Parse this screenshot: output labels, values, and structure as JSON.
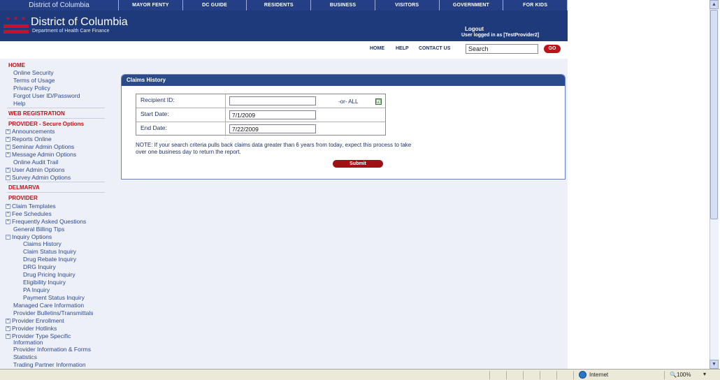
{
  "topnav": {
    "site_name": "District of Columbia",
    "items": [
      "MAYOR FENTY",
      "DC GUIDE",
      "RESIDENTS",
      "BUSINESS",
      "VISITORS",
      "GOVERNMENT",
      "FOR KIDS"
    ]
  },
  "banner": {
    "title": "District of Columbia",
    "subtitle": "Department of Health Care Finance",
    "logout": "Logout",
    "user_line": "User logged in as [TestProvider2]"
  },
  "utility": {
    "home": "HOME",
    "help": "HELP",
    "contact": "CONTACT US",
    "search_value": "Search",
    "go": "GO"
  },
  "sidebar": [
    {
      "label": "HOME",
      "kind": "header"
    },
    {
      "label": "Online Security",
      "kind": "link"
    },
    {
      "label": "Terms of Usage",
      "kind": "link"
    },
    {
      "label": "Privacy Policy",
      "kind": "link"
    },
    {
      "label": "Forgot User ID/Password",
      "kind": "link"
    },
    {
      "label": "Help",
      "kind": "link"
    },
    {
      "label": "WEB REGISTRATION",
      "kind": "header"
    },
    {
      "label": "PROVIDER - Secure Options",
      "kind": "header"
    },
    {
      "label": "Announcements",
      "kind": "expand"
    },
    {
      "label": "Reports Online",
      "kind": "expand"
    },
    {
      "label": "Seminar Admin Options",
      "kind": "expand"
    },
    {
      "label": "Message Admin Options",
      "kind": "expand"
    },
    {
      "label": "Online Audit Trail",
      "kind": "link"
    },
    {
      "label": "User Admin Options",
      "kind": "expand"
    },
    {
      "label": "Survey Admin Options",
      "kind": "expand"
    },
    {
      "label": "DELMARVA",
      "kind": "header"
    },
    {
      "label": "PROVIDER",
      "kind": "header"
    },
    {
      "label": "Claim Templates",
      "kind": "expand"
    },
    {
      "label": "Fee Schedules",
      "kind": "expand"
    },
    {
      "label": "Frequently Asked Questions",
      "kind": "expand"
    },
    {
      "label": "General Billing Tips",
      "kind": "link"
    },
    {
      "label": "Inquiry Options",
      "kind": "collapse"
    },
    {
      "label": "Claims History",
      "kind": "sub"
    },
    {
      "label": "Claim Status Inquiry",
      "kind": "sub"
    },
    {
      "label": "Drug Rebate Inquiry",
      "kind": "sub"
    },
    {
      "label": "DRG Inquiry",
      "kind": "sub"
    },
    {
      "label": "Drug Pricing Inquiry",
      "kind": "sub"
    },
    {
      "label": "Eligibility Inquiry",
      "kind": "sub"
    },
    {
      "label": "PA Inquiry",
      "kind": "sub"
    },
    {
      "label": "Payment Status Inquiry",
      "kind": "sub"
    },
    {
      "label": "Managed Care Information",
      "kind": "link"
    },
    {
      "label": "Provider Bulletins/Transmittals",
      "kind": "link"
    },
    {
      "label": "Provider Enrollment",
      "kind": "expand"
    },
    {
      "label": "Provider Hotlinks",
      "kind": "expand"
    },
    {
      "label": "Provider Type Specific",
      "kind": "expand"
    },
    {
      "label": "Information",
      "kind": "link"
    },
    {
      "label": "Provider Information & Forms",
      "kind": "link"
    },
    {
      "label": "Statistics",
      "kind": "link"
    },
    {
      "label": "Trading Partner Information",
      "kind": "link"
    }
  ],
  "panel": {
    "title": "Claims History",
    "recipient_label": "Recipient ID:",
    "recipient_value": "",
    "or_all": "-or-  ALL",
    "all_checked": "☑",
    "start_label": "Start Date:",
    "start_value": "7/1/2009",
    "end_label": "End Date:",
    "end_value": "7/22/2009",
    "note": "NOTE: If your search criteria pulls back claims data greater than 6 years from today, expect this process to take over one business day to return the report.",
    "submit": "Submit"
  },
  "statusbar": {
    "zone": "Internet",
    "zoom": "100%"
  }
}
